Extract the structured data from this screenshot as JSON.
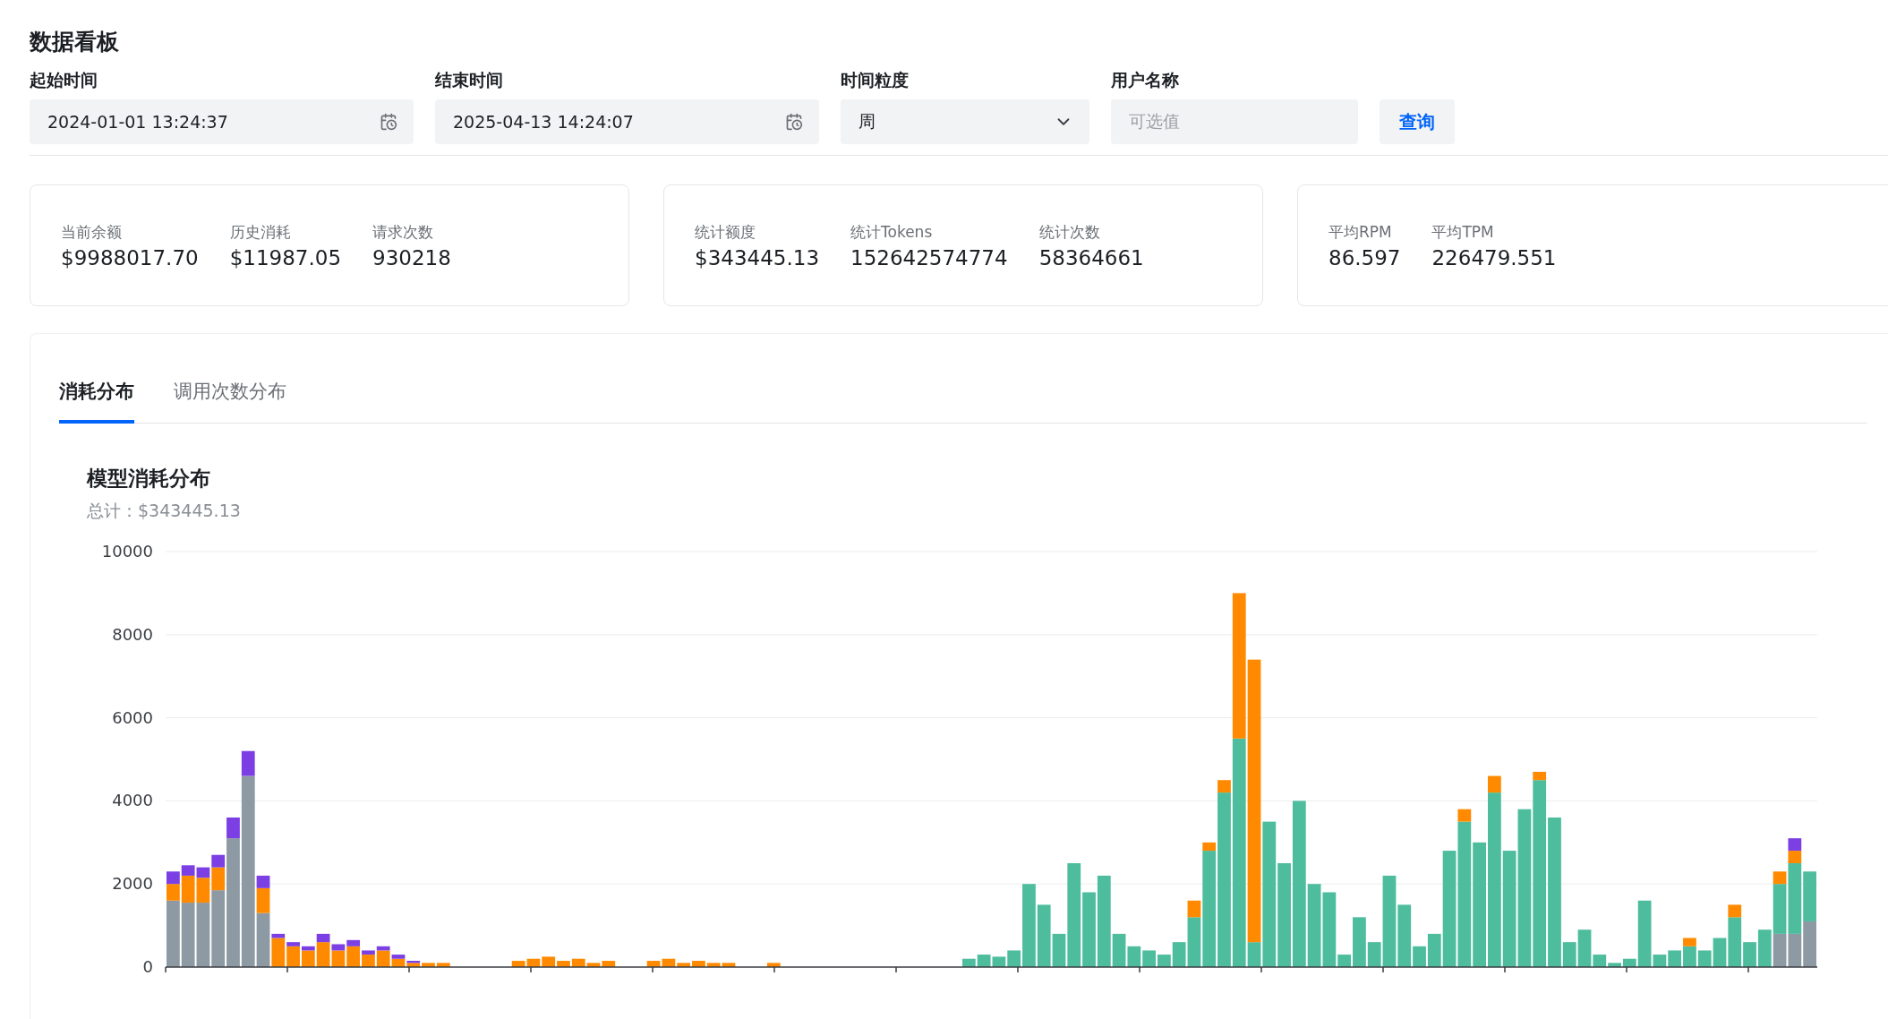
{
  "page_title": "数据看板",
  "filters": [
    {
      "kind": "datetime",
      "label": "起始时间",
      "value": "2024-01-01 13:24:37"
    },
    {
      "kind": "datetime",
      "label": "结束时间",
      "value": "2025-04-13 14:24:07"
    },
    {
      "kind": "select",
      "label": "时间粒度",
      "value": "周"
    },
    {
      "kind": "text",
      "label": "用户名称",
      "placeholder": "可选值"
    }
  ],
  "query_button": "查询",
  "stat_cards": [
    {
      "stats": [
        {
          "label": "当前余额",
          "value": "$9988017.70"
        },
        {
          "label": "历史消耗",
          "value": "$11987.05"
        },
        {
          "label": "请求次数",
          "value": "930218"
        }
      ]
    },
    {
      "stats": [
        {
          "label": "统计额度",
          "value": "$343445.13"
        },
        {
          "label": "统计Tokens",
          "value": "152642574774"
        },
        {
          "label": "统计次数",
          "value": "58364661"
        }
      ]
    },
    {
      "stats": [
        {
          "label": "平均RPM",
          "value": "86.597"
        },
        {
          "label": "平均TPM",
          "value": "226479.551"
        }
      ]
    }
  ],
  "tabs": [
    {
      "label": "消耗分布",
      "selected": true
    },
    {
      "label": "调用次数分布",
      "selected": false
    }
  ],
  "chart_panel": {
    "title": "模型消耗分布",
    "subtitle": "总计：$343445.13",
    "chart_data": {
      "type": "bar",
      "stacked": true,
      "grid": true,
      "ylim": [
        0,
        10000
      ],
      "yticks": [
        0,
        2000,
        4000,
        6000,
        8000,
        10000
      ],
      "series": [
        {
          "color": "#8d9aa3",
          "values": [
            1600,
            1550,
            1550,
            1850,
            3100,
            4600,
            1300,
            0,
            0,
            0,
            0,
            0,
            0,
            0,
            0,
            0,
            0,
            0,
            0,
            0,
            0,
            0,
            0,
            0,
            0,
            0,
            0,
            0,
            0,
            0,
            0,
            0,
            0,
            0,
            0,
            0,
            0,
            0,
            0,
            0,
            0,
            0,
            0,
            0,
            0,
            0,
            0,
            0,
            0,
            0,
            0,
            0,
            0,
            0,
            0,
            0,
            0,
            0,
            0,
            0,
            0,
            0,
            0,
            0,
            0,
            0,
            0,
            0,
            0,
            0,
            0,
            0,
            0,
            0,
            0,
            0,
            0,
            0,
            0,
            0,
            0,
            0,
            0,
            0,
            0,
            0,
            0,
            0,
            0,
            0,
            0,
            0,
            0,
            0,
            0,
            0,
            0,
            0,
            0,
            0,
            0,
            0,
            0,
            0,
            0,
            0,
            0,
            800,
            800,
            1100
          ]
        },
        {
          "color": "#4dbd9e",
          "values": [
            0,
            0,
            0,
            0,
            0,
            0,
            0,
            0,
            0,
            0,
            0,
            0,
            0,
            0,
            0,
            0,
            0,
            0,
            0,
            0,
            0,
            0,
            0,
            0,
            0,
            0,
            0,
            0,
            0,
            0,
            0,
            0,
            0,
            0,
            0,
            0,
            0,
            0,
            0,
            0,
            0,
            0,
            0,
            0,
            0,
            0,
            0,
            0,
            0,
            0,
            0,
            0,
            0,
            200,
            300,
            250,
            400,
            2000,
            1500,
            800,
            2500,
            1800,
            2200,
            800,
            500,
            400,
            300,
            600,
            1200,
            2800,
            4200,
            5500,
            600,
            3500,
            2500,
            4000,
            2000,
            1800,
            300,
            1200,
            600,
            2200,
            1500,
            500,
            800,
            2800,
            3500,
            3000,
            4200,
            2800,
            3800,
            4500,
            3600,
            600,
            900,
            300,
            100,
            200,
            1600,
            300,
            400,
            500,
            400,
            700,
            1200,
            600,
            900,
            1200,
            1700,
            1200
          ]
        },
        {
          "color": "#ff8a00",
          "values": [
            400,
            650,
            600,
            550,
            0,
            0,
            600,
            700,
            500,
            400,
            600,
            400,
            500,
            300,
            400,
            200,
            100,
            100,
            100,
            0,
            0,
            0,
            0,
            150,
            200,
            250,
            150,
            200,
            100,
            150,
            0,
            0,
            150,
            200,
            100,
            150,
            100,
            100,
            0,
            0,
            100,
            0,
            0,
            0,
            0,
            0,
            0,
            0,
            0,
            0,
            0,
            0,
            0,
            0,
            0,
            0,
            0,
            0,
            0,
            0,
            0,
            0,
            0,
            0,
            0,
            0,
            0,
            0,
            400,
            200,
            300,
            3500,
            6800,
            0,
            0,
            0,
            0,
            0,
            0,
            0,
            0,
            0,
            0,
            0,
            0,
            0,
            300,
            0,
            400,
            0,
            0,
            200,
            0,
            0,
            0,
            0,
            0,
            0,
            0,
            0,
            0,
            200,
            0,
            0,
            300,
            0,
            0,
            300,
            300,
            0
          ]
        },
        {
          "color": "#7b3fe4",
          "values": [
            300,
            250,
            250,
            300,
            500,
            600,
            300,
            100,
            100,
            100,
            200,
            150,
            150,
            100,
            100,
            100,
            50,
            0,
            0,
            0,
            0,
            0,
            0,
            0,
            0,
            0,
            0,
            0,
            0,
            0,
            0,
            0,
            0,
            0,
            0,
            0,
            0,
            0,
            0,
            0,
            0,
            0,
            0,
            0,
            0,
            0,
            0,
            0,
            0,
            0,
            0,
            0,
            0,
            0,
            0,
            0,
            0,
            0,
            0,
            0,
            0,
            0,
            0,
            0,
            0,
            0,
            0,
            0,
            0,
            0,
            0,
            0,
            0,
            0,
            0,
            0,
            0,
            0,
            0,
            0,
            0,
            0,
            0,
            0,
            0,
            0,
            0,
            0,
            0,
            0,
            0,
            0,
            0,
            0,
            0,
            0,
            0,
            0,
            0,
            0,
            0,
            0,
            0,
            0,
            0,
            0,
            0,
            0,
            300,
            0
          ]
        }
      ]
    }
  }
}
